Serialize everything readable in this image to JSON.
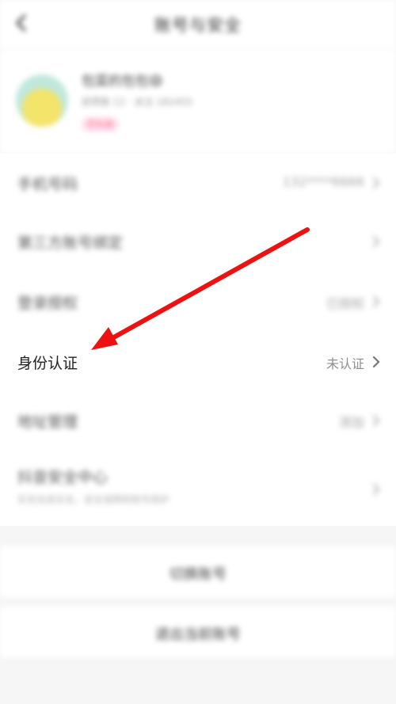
{
  "header": {
    "title": "账号与安全"
  },
  "profile": {
    "nickname": "包菜的包包😄",
    "subtitle": "获赞数 12 · 关注 182455",
    "badge": "已认证"
  },
  "settings": {
    "items": [
      {
        "label": "手机号码",
        "value": "132****6666"
      },
      {
        "label": "第三方账号绑定",
        "value": ""
      },
      {
        "label": "登录授权",
        "value": "已授权"
      },
      {
        "label": "身份认证",
        "value": "未认证"
      },
      {
        "label": "地址管理",
        "value": "添加"
      },
      {
        "label": "抖音安全中心",
        "value": "",
        "subtitle": "实名信息实名，安全保障和账号保护"
      }
    ]
  },
  "actions": {
    "switch_account": "切换账号",
    "logout": "退出当前账号"
  },
  "colors": {
    "annotation_arrow": "#ee1111",
    "background": "#f6f6f6"
  }
}
